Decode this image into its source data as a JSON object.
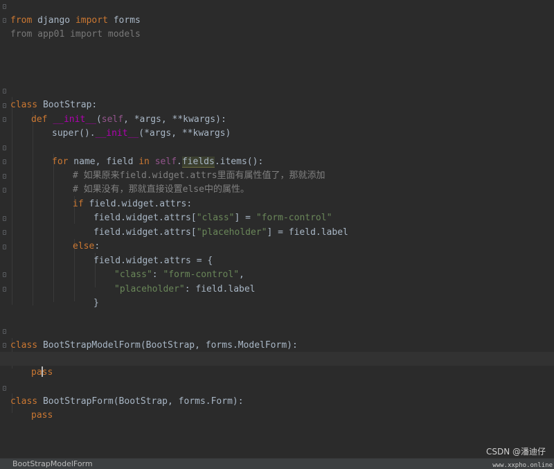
{
  "editor": {
    "language": "python",
    "colors": {
      "background": "#2b2b2b",
      "keyword": "#cc7832",
      "builtin_magic": "#b200b2",
      "self": "#94558d",
      "string": "#6a8759",
      "comment": "#808080",
      "text": "#a9b7c6"
    },
    "lines": {
      "l1": {
        "kw1": "from",
        "t1": " django ",
        "kw2": "import",
        "t2": " forms"
      },
      "l2": {
        "text": "from app01 import models"
      },
      "l7": {
        "kw": "class",
        "t": " BootStrap:"
      },
      "l8": {
        "kw": "def",
        "sp": " ",
        "magic": "__init__",
        "p1": "(",
        "self": "self",
        "p2": ", *args, **kwargs):"
      },
      "l9": {
        "t1": "super().",
        "magic": "__init__",
        "t2": "(*args, **kwargs)"
      },
      "l11": {
        "kw1": "for",
        "t1": " name, field ",
        "kw2": "in",
        "sp": " ",
        "self": "self",
        "dot": ".",
        "field": "fields",
        "t2": ".items():"
      },
      "l12": {
        "comment": "# 如果原来field.widget.attrs里面有属性值了，那就添加"
      },
      "l13": {
        "comment": "# 如果没有，那就直接设置else中的属性。"
      },
      "l14": {
        "kw": "if",
        "t": " field.widget.attrs:"
      },
      "l15": {
        "t1": "field.widget.attrs[",
        "s1": "\"class\"",
        "t2": "] = ",
        "s2": "\"form-control\""
      },
      "l16": {
        "t1": "field.widget.attrs[",
        "s1": "\"placeholder\"",
        "t2": "] = field.label"
      },
      "l17": {
        "kw": "else",
        "t": ":"
      },
      "l18": {
        "t": "field.widget.attrs = {"
      },
      "l19": {
        "s1": "\"class\"",
        "t1": ": ",
        "s2": "\"form-control\"",
        "t2": ","
      },
      "l20": {
        "s1": "\"placeholder\"",
        "t1": ": field.label"
      },
      "l21": {
        "t": "}"
      },
      "l24": {
        "kw": "class",
        "t": " BootStrapModelForm(BootStrap, forms.ModelForm):"
      },
      "l25": {
        "ellipsis": "..."
      },
      "l26": {
        "pa": "pa",
        "ss": "ss"
      },
      "l28": {
        "kw": "class",
        "t": " BootStrapForm(BootStrap, forms.Form):"
      },
      "l29": {
        "kw": "pass"
      }
    }
  },
  "statusbar": {
    "breadcrumb": "BootStrapModelForm"
  },
  "watermark": {
    "credit": "CSDN @潘迪仔",
    "site": "www.xxpho.online"
  }
}
